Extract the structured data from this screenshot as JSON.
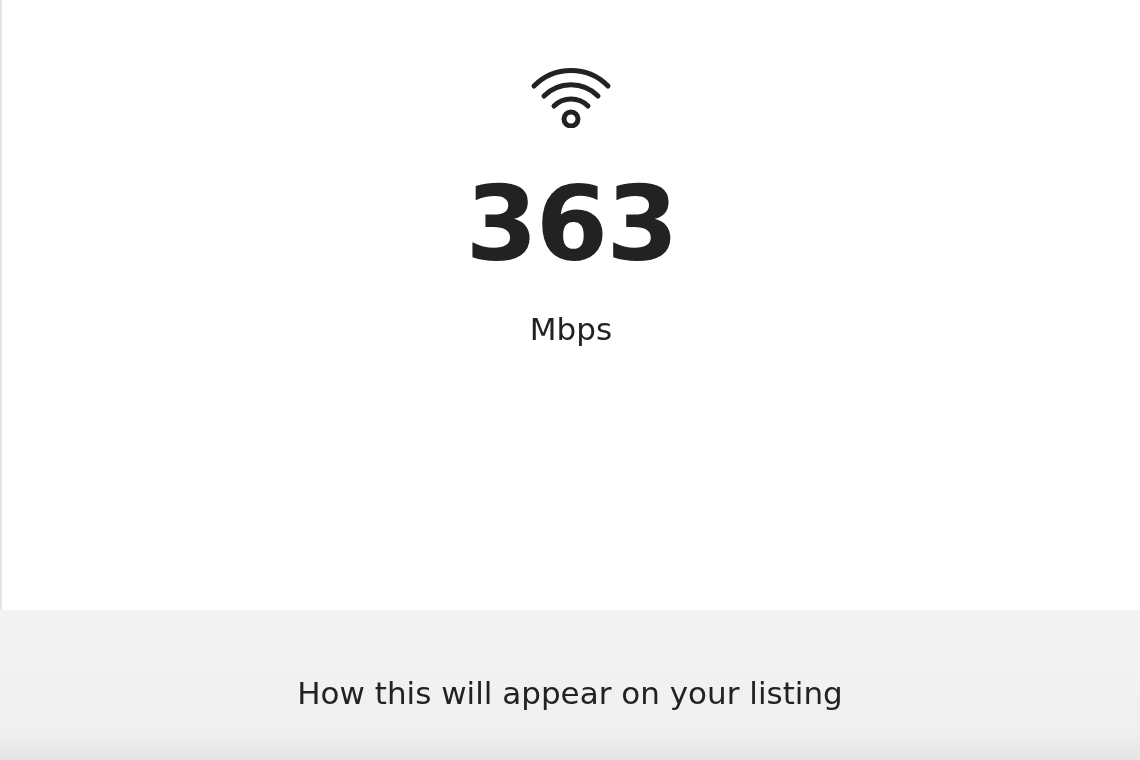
{
  "speed": {
    "value": "363",
    "unit": "Mbps"
  },
  "preview": {
    "title": "How this will appear on your listing"
  }
}
